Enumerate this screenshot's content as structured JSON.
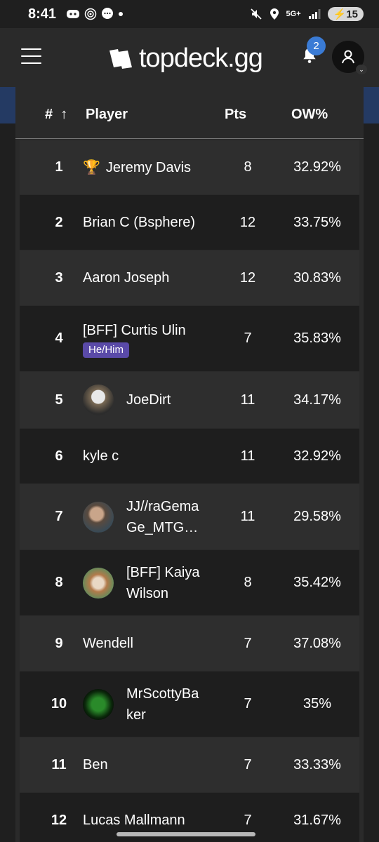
{
  "status_bar": {
    "time": "8:41",
    "network": "5G+",
    "battery": "15"
  },
  "header": {
    "logo_text": "topdeck.gg",
    "notification_count": "2"
  },
  "table": {
    "columns": {
      "rank": "#",
      "sort_arrow": "↑",
      "player": "Player",
      "pts": "Pts",
      "ow": "OW%"
    },
    "rows": [
      {
        "rank": "1",
        "trophy": "🏆",
        "player": "Jeremy Davis",
        "pts": "8",
        "ow": "32.92%"
      },
      {
        "rank": "2",
        "player": "Brian C (Bsphere)",
        "pts": "12",
        "ow": "33.75%"
      },
      {
        "rank": "3",
        "player": "Aaron Joseph",
        "pts": "12",
        "ow": "30.83%"
      },
      {
        "rank": "4",
        "player": "[BFF] Curtis Ulin",
        "pronoun": "He/Him",
        "pts": "7",
        "ow": "35.83%"
      },
      {
        "rank": "5",
        "player": "JoeDirt",
        "pts": "11",
        "ow": "34.17%"
      },
      {
        "rank": "6",
        "player": "kyle c",
        "pts": "11",
        "ow": "32.92%"
      },
      {
        "rank": "7",
        "player_line1": "JJ//raGema",
        "player_line2": "Ge_MTG…",
        "pts": "11",
        "ow": "29.58%"
      },
      {
        "rank": "8",
        "player_line1": "[BFF] Kaiya",
        "player_line2": "Wilson",
        "pts": "8",
        "ow": "35.42%"
      },
      {
        "rank": "9",
        "player": "Wendell",
        "pts": "7",
        "ow": "37.08%"
      },
      {
        "rank": "10",
        "player_line1": "MrScottyBa",
        "player_line2": "ker",
        "pts": "7",
        "ow": "35%"
      },
      {
        "rank": "11",
        "player": "Ben",
        "pts": "7",
        "ow": "33.33%"
      },
      {
        "rank": "12",
        "player": "Lucas Mallmann",
        "pts": "7",
        "ow": "31.67%"
      }
    ]
  }
}
